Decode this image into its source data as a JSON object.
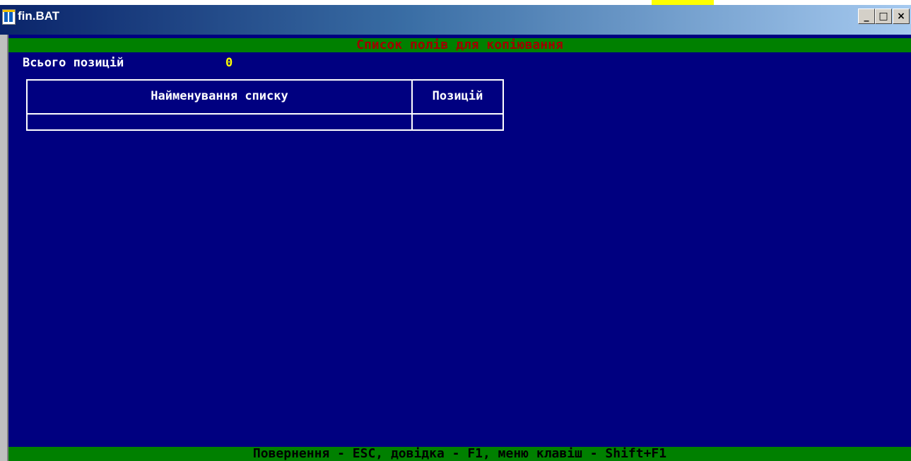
{
  "window": {
    "title": "fin.BAT",
    "controls": {
      "minimize": "_",
      "maximize": "□",
      "close": "×"
    }
  },
  "header": {
    "title": "Список полів для копіювання"
  },
  "summary": {
    "total_label": "Всього позицій",
    "total_value": "0"
  },
  "table": {
    "columns": [
      "Найменування списку",
      "Позицій"
    ],
    "rows": []
  },
  "status_bar": {
    "text": "Повернення - ESC, довідка - F1, меню клавіш - Shift+F1"
  },
  "colors": {
    "console_bg": "#000080",
    "bar_bg": "#008000",
    "header_text": "#a00000",
    "value_text": "#ffff00"
  }
}
